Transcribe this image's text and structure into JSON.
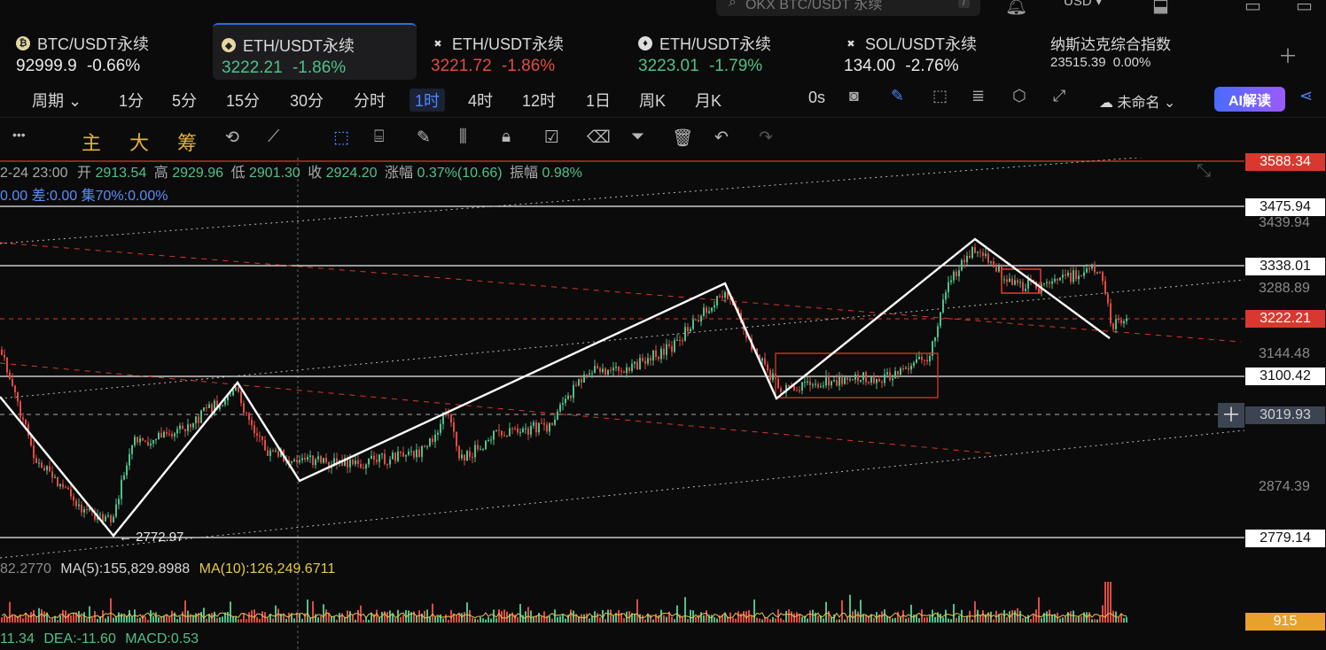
{
  "search": {
    "placeholder": "OKX BTC/USDT 永续",
    "shortcut": "/"
  },
  "currency": "USD",
  "tickers": [
    {
      "name": "BTC/USDT永续",
      "price": "92999.9",
      "change": "-0.66%",
      "price_color": "#e8e8e8",
      "change_color": "#e8e8e8",
      "icon": "btc-icon"
    },
    {
      "name": "ETH/USDT永续",
      "price": "3222.21",
      "change": "-1.86%",
      "price_color": "#4ec18b",
      "change_color": "#4ec18b",
      "icon": "eth-icon"
    },
    {
      "name": "ETH/USDT永续",
      "price": "3221.72",
      "change": "-1.86%",
      "price_color": "#e04b44",
      "change_color": "#e04b44",
      "icon": "x-icon"
    },
    {
      "name": "ETH/USDT永续",
      "price": "3223.01",
      "change": "-1.79%",
      "price_color": "#4ec18b",
      "change_color": "#4ec18b",
      "icon": "drop-icon"
    },
    {
      "name": "SOL/USDT永续",
      "price": "134.00",
      "change": "-2.76%",
      "price_color": "#e8e8e8",
      "change_color": "#e8e8e8",
      "icon": "x-icon"
    },
    {
      "name": "纳斯达克综合指数",
      "price": "23515.39",
      "change": "0.00%",
      "price_color": "#d6d6d6",
      "change_color": "#d6d6d6",
      "icon": ""
    }
  ],
  "periods": {
    "period_menu": "周期",
    "items": [
      "1分",
      "5分",
      "15分",
      "30分",
      "分时",
      "1时",
      "4时",
      "12时",
      "1日",
      "周K",
      "月K"
    ],
    "selected": "1时",
    "countdown": "0s",
    "layout_name": "未命名",
    "ai_label": "AI解读"
  },
  "drawbar": {
    "main": "主",
    "big": "大",
    "chip": "筹"
  },
  "info": {
    "date": "2-24 23:00",
    "open_label": "开",
    "open": "2913.54",
    "high_label": "高",
    "high": "2929.96",
    "low_label": "低",
    "low": "2901.30",
    "close_label": "收",
    "close": "2924.20",
    "range_label": "涨幅",
    "range": "0.37%(10.66)",
    "amp_label": "振幅",
    "amp": "0.98%",
    "line2": "0.00 差:0.00 集70%:0.00%"
  },
  "price_axis": {
    "labels": [
      "3588.34",
      "3475.94",
      "3439.94",
      "3338.01",
      "3288.89",
      "3222.21",
      "3144.48",
      "3100.42",
      "3019.93",
      "2874.39",
      "2779.14"
    ],
    "volume": "915"
  },
  "low_marker": "← 2772.97",
  "volume_ma": {
    "prefix": "82.2770",
    "ma5": "MA(5):155,829.8988",
    "ma10": "MA(10):126,249.6711"
  },
  "macd": {
    "prefix": "11.34",
    "dea": "DEA:-11.60",
    "macd": "MACD:0.53"
  },
  "colors": {
    "up": "#4ec18b",
    "down": "#e04b44",
    "accent": "#4f86ff",
    "gold": "#e3b23c"
  }
}
